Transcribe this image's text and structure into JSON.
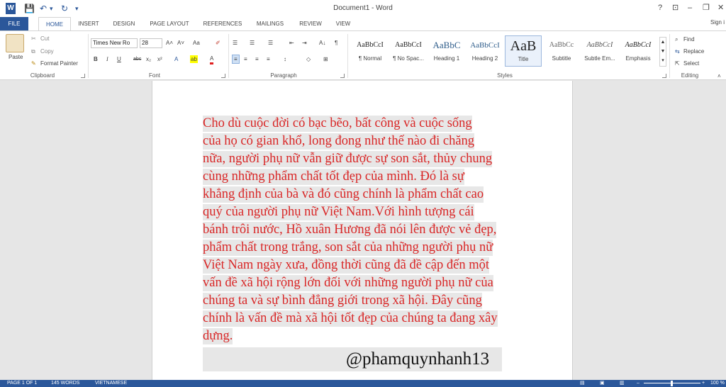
{
  "titlebar": {
    "title": "Document1 - Word",
    "help": "?",
    "ribbon_display": "⊡",
    "minimize": "–",
    "restore": "❐",
    "close": "✕"
  },
  "quick_access": {
    "word": "W",
    "save": "💾",
    "undo": "↶",
    "undo_dd": "▾",
    "redo": "↻",
    "customize": "▾"
  },
  "tabs": [
    "FILE",
    "HOME",
    "INSERT",
    "DESIGN",
    "PAGE LAYOUT",
    "REFERENCES",
    "MAILINGS",
    "REVIEW",
    "VIEW"
  ],
  "signin": "Sign i",
  "clipboard": {
    "paste": "Paste",
    "cut": "Cut",
    "copy": "Copy",
    "format_painter": "Format Painter",
    "label": "Clipboard"
  },
  "font": {
    "name": "Times New Ro",
    "size": "28",
    "grow": "A˄",
    "shrink": "A˅",
    "change_case": "Aa",
    "clear": "✐",
    "bold": "B",
    "italic": "I",
    "underline": "U",
    "strike": "abc",
    "sub": "x₂",
    "sup": "x²",
    "effects": "A",
    "highlight": "ab",
    "color": "A",
    "label": "Font"
  },
  "paragraph": {
    "bullets": "☰",
    "numbering": "☰",
    "multilevel": "☰",
    "dec_indent": "⇤",
    "inc_indent": "⇥",
    "sort": "A↓",
    "pilcrow": "¶",
    "align_left": "≡",
    "align_center": "≡",
    "align_right": "≡",
    "justify": "≡",
    "line_spacing": "↕",
    "shading": "◇",
    "borders": "⊞",
    "label": "Paragraph"
  },
  "styles": {
    "items": [
      {
        "sample": "AaBbCcI",
        "name": "¶ Normal"
      },
      {
        "sample": "AaBbCcI",
        "name": "¶ No Spac..."
      },
      {
        "sample": "AaBbC",
        "name": "Heading 1"
      },
      {
        "sample": "AaBbCcI",
        "name": "Heading 2"
      },
      {
        "sample": "AaB",
        "name": "Title"
      },
      {
        "sample": "AaBbCc",
        "name": "Subtitle"
      },
      {
        "sample": "AaBbCcI",
        "name": "Subtle Em..."
      },
      {
        "sample": "AaBbCcI",
        "name": "Emphasis"
      }
    ],
    "label": "Styles"
  },
  "editing": {
    "find": "Find",
    "replace": "Replace",
    "select": "Select",
    "label": "Editing"
  },
  "document": {
    "lines": [
      "  Cho dù cuộc đời có bạc bẽo, bất công và cuộc sống",
      "của họ có gian khổ, long đong như thế nào đi chăng",
      "nữa, người phụ nữ vẫn giữ được sự son sắt, thủy chung",
      "cùng những phẩm chất tốt đẹp của mình. Đó là sự",
      "khẳng định của bà và đó cũng chính là phẩm chất cao",
      "quý của người phụ nữ Việt Nam.Với hình tượng cái",
      "bánh trôi nước, Hồ xuân Hương đã nói lên được vẻ đẹp,",
      "phẩm chất trong trắng, son sắt của những người phụ nữ",
      "Việt Nam ngày xưa, đồng thời cũng đã đề cập đến một",
      "vấn đề xã hội rộng lớn đối với những người phụ nữ của",
      "chúng ta và sự bình đẳng giới trong xã hội. Đây cũng",
      "chính là vấn đề mà xã hội tốt đẹp của chúng ta đang xây",
      "dựng."
    ],
    "signature": "@phamquynhanh13",
    "text_color": "#d92626"
  },
  "status": {
    "page": "PAGE 1 OF 1",
    "words": "145 WORDS",
    "language": "VIETNAMESE",
    "zoom": "100 %",
    "zoom_minus": "–",
    "zoom_plus": "+"
  },
  "colors": {
    "accent": "#2b579a"
  }
}
